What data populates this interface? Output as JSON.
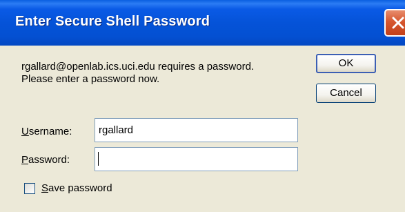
{
  "window": {
    "title": "Enter Secure Shell Password"
  },
  "message": {
    "line1": "rgallard@openlab.ics.uci.edu requires a password.",
    "line2": "Please enter a password now."
  },
  "buttons": {
    "ok_label": "OK",
    "cancel_label": "Cancel"
  },
  "username": {
    "label_accel": "U",
    "label_rest": "sername:",
    "value": "rgallard"
  },
  "password": {
    "label_accel": "P",
    "label_rest": "assword:",
    "value": ""
  },
  "save_password": {
    "label_accel": "S",
    "label_rest": "ave password",
    "checked": false
  },
  "colors": {
    "titlebar": "#0553d8",
    "dialog_bg": "#ece9d8",
    "close_button": "#d6572f",
    "input_border": "#7f9db9"
  },
  "icons": {
    "close": "close-icon"
  }
}
